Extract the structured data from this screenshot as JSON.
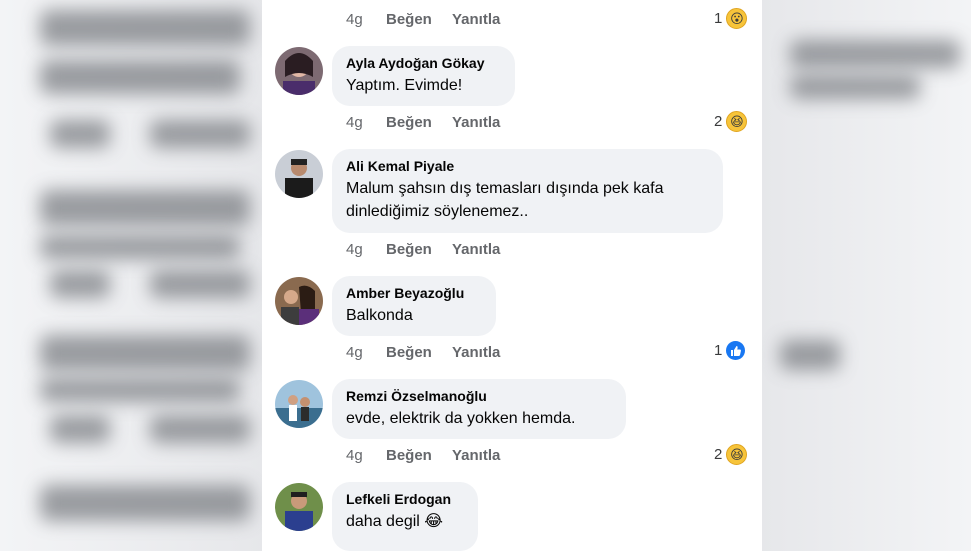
{
  "meta_labels": {
    "time": "4g",
    "like": "Beğen",
    "reply": "Yanıtla"
  },
  "top_row": {
    "reaction_count": "1",
    "reaction_icon": "wow-emoji-icon"
  },
  "comments": [
    {
      "name": "Ayla Aydoğan Gökay",
      "text": "Yaptım. Evimde!",
      "reaction_count": "2",
      "reaction_icon": "haha-emoji-icon"
    },
    {
      "name": "Ali Kemal Piyale",
      "text_lines": [
        "Malum şahsın dış temasları dışında pek kafa",
        "dinlediğimiz söylenemez.."
      ],
      "reaction_count": "",
      "reaction_icon": ""
    },
    {
      "name": "Amber Beyazoğlu",
      "text": "Balkonda",
      "reaction_count": "1",
      "reaction_icon": "like-icon"
    },
    {
      "name": "Remzi Özselmanoğlu",
      "text": "evde, elektrik da yokken hemda.",
      "reaction_count": "2",
      "reaction_icon": "haha-emoji-icon"
    },
    {
      "name": "Lefkeli Erdogan",
      "text": "daha degil",
      "text_emoji": "😂"
    }
  ],
  "colors": {
    "bubble": "#f0f2f5",
    "meta_text": "#65676b",
    "like_blue": "#1877f2",
    "emoji_yellow": "#f7c43a"
  }
}
